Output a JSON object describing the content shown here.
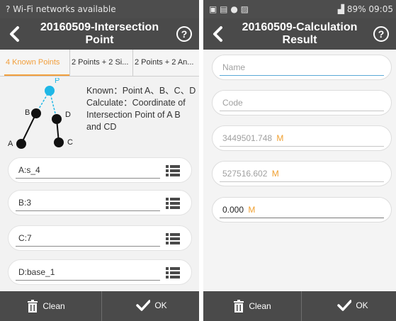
{
  "left": {
    "status": {
      "left": "Wi-Fi networks available"
    },
    "title_line1": "20160509-Intersection",
    "title_line2": "Point",
    "tabs": [
      "4 Known Points",
      "2 Points + 2 Si...",
      "2 Points + 2 An..."
    ],
    "diagram_labels": {
      "p": "P",
      "a": "A",
      "b": "B",
      "c": "C",
      "d": "D"
    },
    "description": {
      "known": "Known：Point A、B、C、D",
      "calculate": "Calculate：Coordinate of Intersection Point of A B and CD"
    },
    "fields": [
      {
        "value": "A:s_4"
      },
      {
        "value": "B:3"
      },
      {
        "value": "C:7"
      },
      {
        "value": "D:base_1"
      }
    ],
    "bottom": {
      "clean": "Clean",
      "ok": "OK"
    }
  },
  "right": {
    "status": {
      "right": "89%  09:05"
    },
    "title_line1": "20160509-Calculation",
    "title_line2": "Result",
    "fields": [
      {
        "text": "Name",
        "unit": ""
      },
      {
        "text": "Code",
        "unit": ""
      },
      {
        "text": "3449501.748",
        "unit": "M"
      },
      {
        "text": "527516.602",
        "unit": "M"
      },
      {
        "text": "0.000",
        "unit": "M"
      }
    ],
    "bottom": {
      "clean": "Clean",
      "ok": "OK"
    }
  },
  "colors": {
    "accent": "#f29f3d",
    "bar": "#4a4a4a",
    "point": "#1fb7e6"
  }
}
